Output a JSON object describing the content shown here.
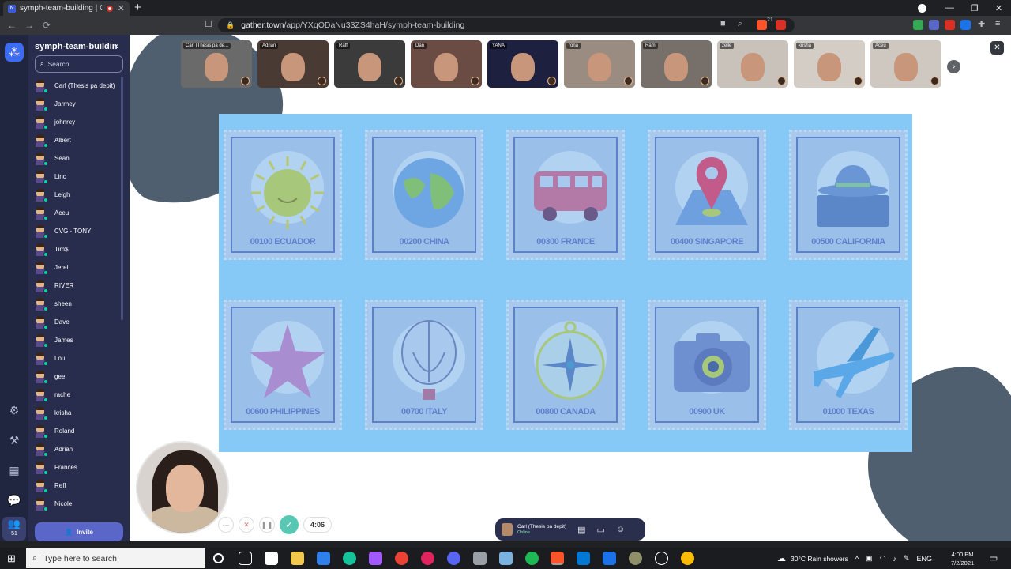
{
  "browser": {
    "tab_title": "symph-team-building | Gathe",
    "url_domain": "gather.town",
    "url_path": "/app/YXqODaNu33ZS4haH/symph-team-building",
    "ext_badge": "21"
  },
  "sidebar": {
    "space_name": "symph-team-building",
    "search_placeholder": "Search",
    "members": [
      "Carl (Thesis pa depit)",
      "Jarrhey",
      "johnrey",
      "Albert",
      "Sean",
      "Linc",
      "Leigh",
      "Aceu",
      "CVG - TONY",
      "Tim$",
      "Jerel",
      "RIVER",
      "sheen",
      "Dave",
      "James",
      "Lou",
      "gee",
      "rache",
      "krisha",
      "Roland",
      "Adrian",
      "Frances",
      "Reff",
      "Nicole"
    ],
    "invite_label": "Invite",
    "people_count": "51"
  },
  "video_tiles": [
    {
      "name": "Carl (Thesis pa de...",
      "color": "#6a6a6a"
    },
    {
      "name": "Adrian",
      "color": "#4a3a34"
    },
    {
      "name": "Raff",
      "color": "#3b3b3b"
    },
    {
      "name": "Dan",
      "color": "#6b4c44"
    },
    {
      "name": "YANA",
      "color": "#1e2040"
    },
    {
      "name": "rona",
      "color": "#9a8c80"
    },
    {
      "name": "Ram",
      "color": "#77706a"
    },
    {
      "name": "zelle",
      "color": "#c8c2bb"
    },
    {
      "name": "krisha",
      "color": "#d4cdc6"
    },
    {
      "name": "Aceu",
      "color": "#cfc8c0"
    }
  ],
  "stamps": [
    {
      "label": "00100 ECUADOR",
      "icon": "sun-icon"
    },
    {
      "label": "00200 CHINA",
      "icon": "globe-icon"
    },
    {
      "label": "00300 FRANCE",
      "icon": "bus-icon"
    },
    {
      "label": "00400 SINGAPORE",
      "icon": "map-pin-icon"
    },
    {
      "label": "00500 CALIFORNIA",
      "icon": "hat-icon"
    },
    {
      "label": "00600 PHILIPPINES",
      "icon": "starfish-icon"
    },
    {
      "label": "00700 ITALY",
      "icon": "balloon-icon"
    },
    {
      "label": "00800 CANADA",
      "icon": "compass-icon"
    },
    {
      "label": "00900 UK",
      "icon": "camera-icon"
    },
    {
      "label": "01000 TEXAS",
      "icon": "airplane-icon"
    }
  ],
  "recording": {
    "timer": "4:06"
  },
  "status": {
    "name": "Carl (Thesis pa depit)",
    "state": "Online"
  },
  "taskbar": {
    "search_placeholder": "Type here to search",
    "weather": "30°C  Rain showers",
    "lang": "ENG",
    "time": "4:00 PM",
    "date": "7/2/2021"
  }
}
